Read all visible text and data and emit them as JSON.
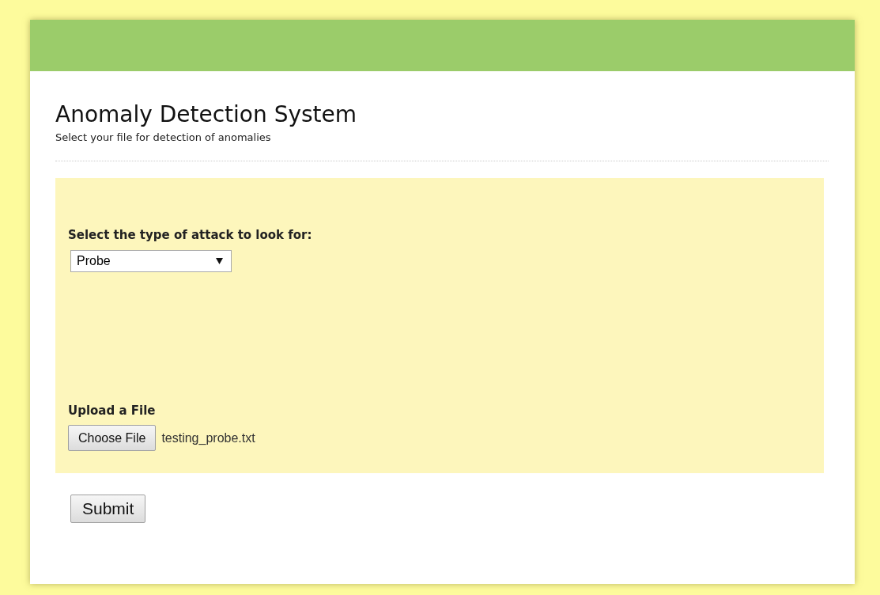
{
  "header": {
    "title": "Anomaly Detection System",
    "subtitle": "Select your file for detection of anomalies"
  },
  "form": {
    "attack_type": {
      "label": "Select the type of attack to look for:",
      "value": "Probe"
    },
    "upload": {
      "label": "Upload a File",
      "button": "Choose File",
      "file_name": "testing_probe.txt"
    }
  },
  "submit": "Submit"
}
